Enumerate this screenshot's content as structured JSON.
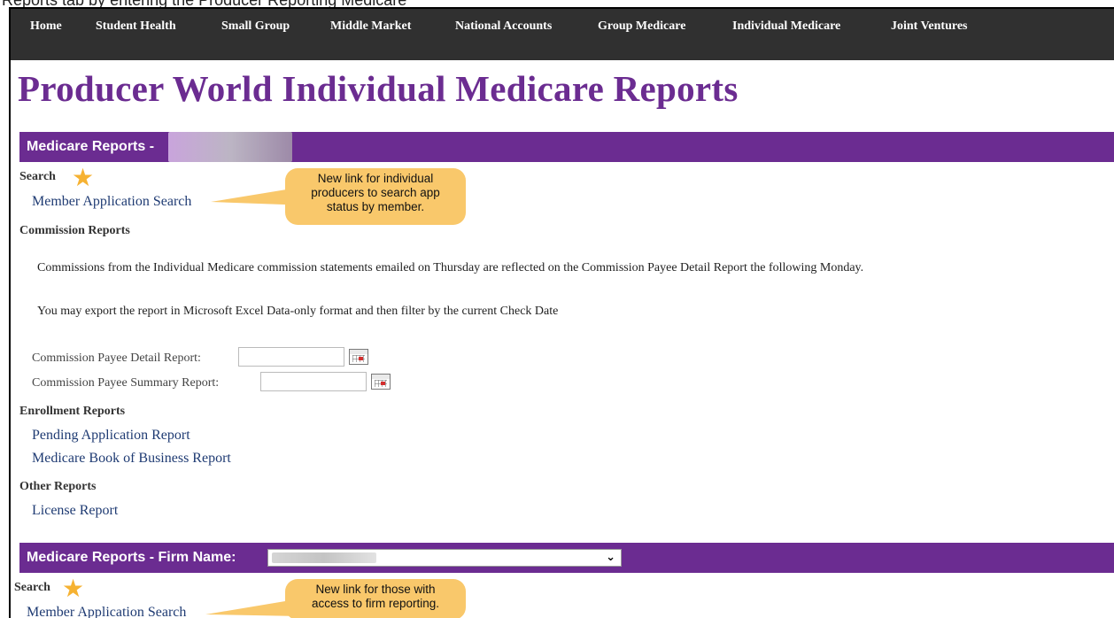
{
  "caption": "Reports tab by entering the Producer Reporting Medicare",
  "nav": [
    "Home",
    "Student Health",
    "Small Group",
    "Middle Market",
    "National Accounts",
    "Group Medicare",
    "Individual Medicare",
    "Joint Ventures"
  ],
  "title": "Producer World Individual Medicare Reports",
  "section1": {
    "header": "Medicare Reports -",
    "search_heading": "Search",
    "search_link": "Member Application Search",
    "callout": [
      "New link for individual",
      "producers to search app",
      "status by member."
    ],
    "commission_heading": "Commission Reports",
    "para1": "Commissions from the Individual Medicare commission statements emailed on Thursday are reflected on the Commission Payee Detail Report the following Monday.",
    "para2": "You may export the report in Microsoft Excel Data-only format and then filter by the current Check Date",
    "detail_label": "Commission Payee Detail Report:",
    "summary_label": "Commission Payee Summary Report:",
    "enrollment_heading": "Enrollment Reports",
    "pending_link": "Pending Application Report",
    "book_link": "Medicare Book of Business Report",
    "other_heading": "Other Reports",
    "license_link": "License Report"
  },
  "section2": {
    "header": "Medicare Reports - Firm Name:",
    "search_heading": "Search",
    "search_link": "Member Application Search",
    "callout": [
      "New link for those with",
      "access to firm reporting."
    ]
  },
  "colors": {
    "purple": "#6b2c91",
    "nav_bg": "#303030",
    "callout": "#f9c86b",
    "star": "#f6b232",
    "link": "#1f3b73"
  },
  "icons": [
    "star-icon",
    "calendar-icon",
    "chevron-down-icon"
  ]
}
